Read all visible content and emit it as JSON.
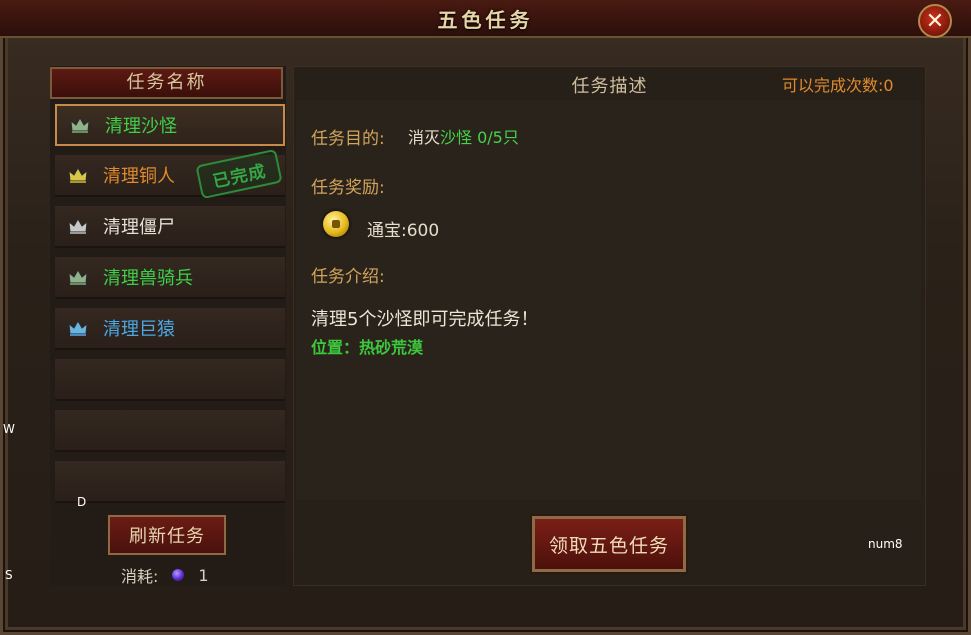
{
  "window": {
    "title": "五色任务",
    "close_label": "✕"
  },
  "left": {
    "header": "任务名称",
    "tasks": [
      {
        "label": "清理沙怪",
        "color": "#3fd04a",
        "crown_color": "#8fb28a",
        "selected": true
      },
      {
        "label": "清理铜人",
        "color": "#e08a2c",
        "crown_color": "#d8c64a",
        "stamp": "已完成"
      },
      {
        "label": "清理僵尸",
        "color": "#e6e0d6",
        "crown_color": "#c8c8c8"
      },
      {
        "label": "清理兽骑兵",
        "color": "#3fd04a",
        "crown_color": "#8fb28a"
      },
      {
        "label": "清理巨猿",
        "color": "#4aa8e6",
        "crown_color": "#6ab4e0"
      }
    ],
    "refresh_button": "刷新任务",
    "cost_label": "消耗:",
    "cost_value": "1"
  },
  "right": {
    "header": "任务描述",
    "complete_count": "可以完成次数:0",
    "goal_label": "任务目的:",
    "goal_prefix": "消灭",
    "goal_target": "沙怪 0/5只",
    "reward_label": "任务奖励:",
    "reward_text": "通宝:600",
    "intro_label": "任务介绍:",
    "intro_text": "清理5个沙怪即可完成任务！",
    "location": "位置：热砂荒漠",
    "accept_button": "领取五色任务"
  },
  "hints": {
    "w": "W",
    "d": "D",
    "s": "S",
    "num8": "num8"
  }
}
